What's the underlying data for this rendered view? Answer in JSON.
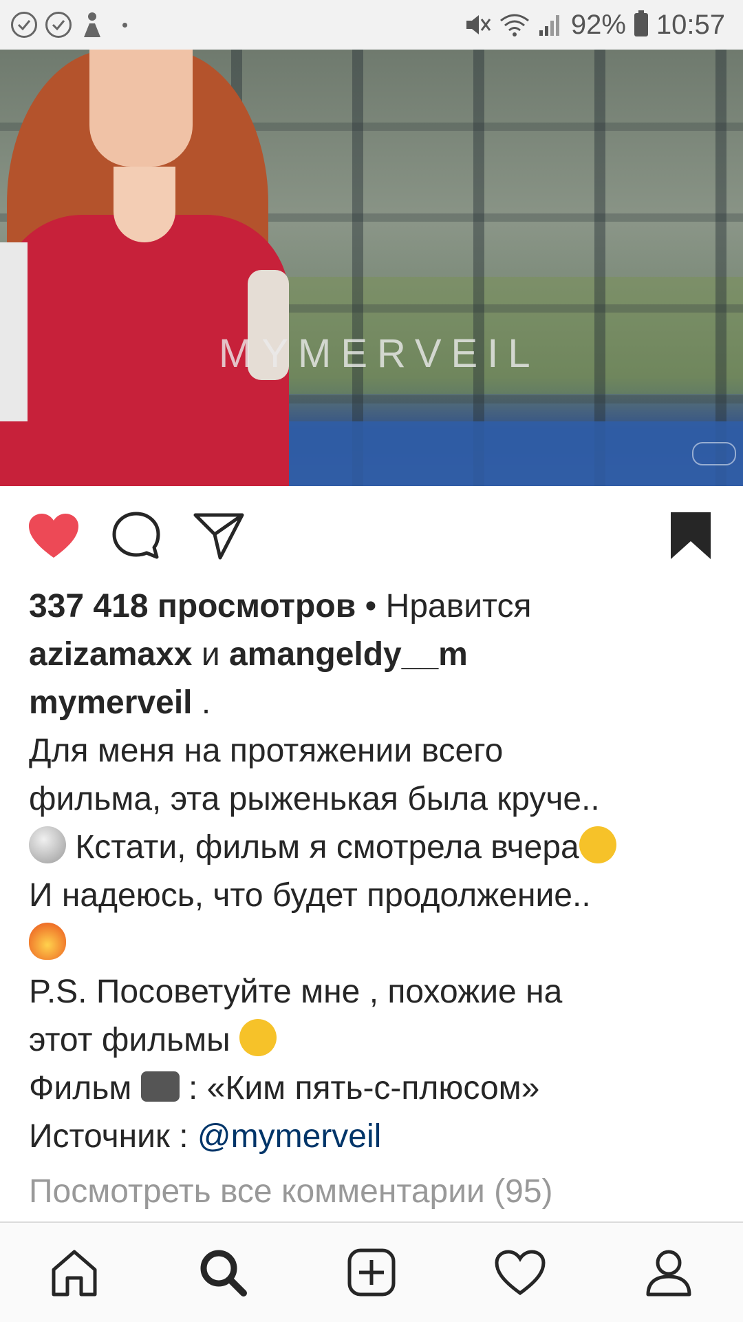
{
  "status_bar": {
    "battery": "92%",
    "time": "10:57"
  },
  "media": {
    "watermark": "MYMERVEIL"
  },
  "post": {
    "views": "337 418 просмотров",
    "liked_sep": " • Нравится",
    "liker1": "azizamaxx",
    "and": " и ",
    "liker2": "amangeldy__m",
    "author": "mymerveil",
    "author_suffix": " .",
    "caption_line1": "Для меня на протяжении всего",
    "caption_line2": "фильма, эта рыженькая была круче..",
    "caption_line3": " Кстати, фильм я смотрела вчера",
    "caption_line4": "И надеюсь, что будет продолжение..",
    "caption_line6": "P.S. Посоветуйте мне , похожие на",
    "caption_line7": "этот фильмы ",
    "caption_line8_a": "Фильм ",
    "caption_line8_b": " : «Ким пять-с-плюсом»",
    "caption_line9_a": "Источник : ",
    "caption_line9_link": "@mymerveil",
    "view_comments": "Посмотреть все комментарии (95)"
  },
  "icons": {
    "like": "heart-filled-icon",
    "comment": "comment-icon",
    "share": "send-icon",
    "save": "bookmark-filled-icon"
  },
  "nav": {
    "items": [
      "home-icon",
      "search-icon",
      "new-post-icon",
      "activity-icon",
      "profile-icon"
    ]
  },
  "colors": {
    "like": "#ed4956",
    "link": "#003569",
    "muted": "#999999"
  }
}
